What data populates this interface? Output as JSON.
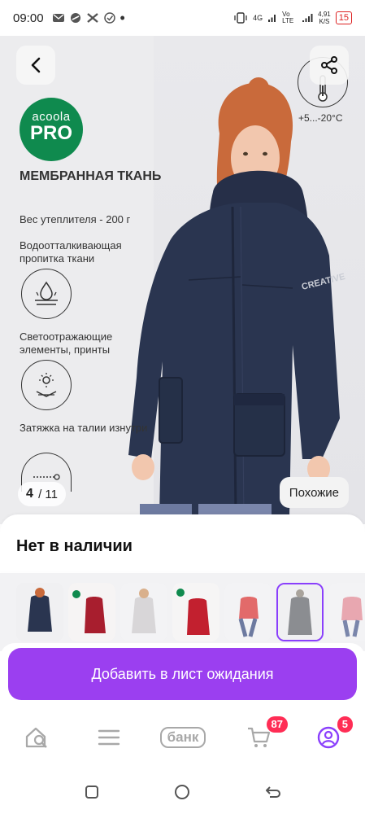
{
  "status_bar": {
    "time": "09:00",
    "network_gen": "4G",
    "signal_label": "Vo LTE",
    "speed_value": "4,91",
    "speed_unit": "K/S",
    "battery": "15"
  },
  "hero": {
    "photo_counter_current": "4",
    "photo_counter_total": "11",
    "similar_label": "Похожие",
    "temperature": "+5...-20°C",
    "brand_line1": "acoola",
    "brand_line2": "PRO",
    "feature_title": "МЕМБРАННАЯ ТКАНЬ",
    "insulation": "Вес утеплителя - 200 г",
    "features": [
      {
        "label": "Водоотталкивающая пропитка ткани",
        "icon": "water-repellent-icon"
      },
      {
        "label": "Светоотражающие элементы, принты",
        "icon": "reflective-icon"
      },
      {
        "label": "Затяжка на талии изнутри",
        "icon": "waist-drawstring-icon"
      }
    ],
    "sleeve_print": "CREATIVE"
  },
  "availability": {
    "title": "Нет в наличии"
  },
  "thumbnails": {
    "count": 7,
    "selected_index": 5,
    "colors": [
      "#2a3550",
      "#a81e2e",
      "#d8d6d8",
      "#c2202f",
      "#e26a6a",
      "#8b8d91",
      "#e8a7b0"
    ]
  },
  "cta": {
    "label": "Добавить в лист ожидания",
    "color": "#9b3ff0"
  },
  "bottom_nav": {
    "items": [
      {
        "icon": "home-search-icon"
      },
      {
        "icon": "menu-icon"
      },
      {
        "icon": "bank-icon",
        "label": "банк"
      },
      {
        "icon": "cart-icon",
        "badge": "87"
      },
      {
        "icon": "profile-icon",
        "badge": "5"
      }
    ]
  }
}
